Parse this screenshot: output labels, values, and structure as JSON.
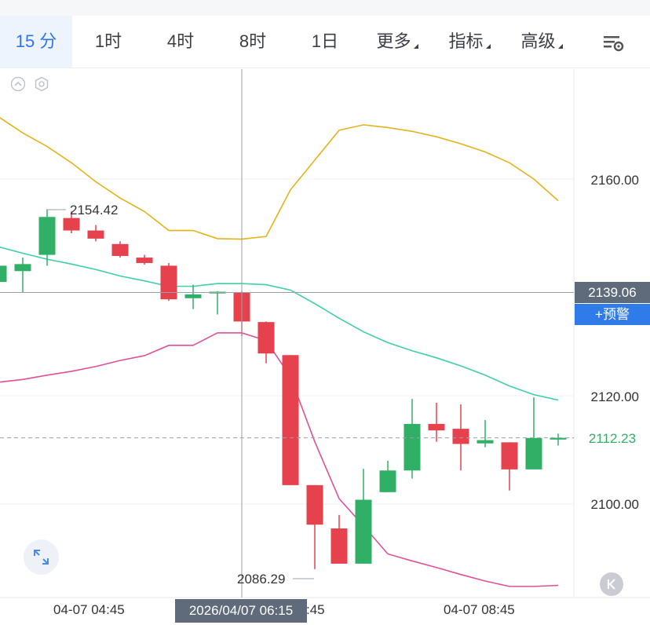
{
  "toolbar": {
    "tabs": [
      {
        "label": "15 分",
        "active": true
      },
      {
        "label": "1时"
      },
      {
        "label": "4时"
      },
      {
        "label": "8时"
      },
      {
        "label": "1日"
      },
      {
        "label": "更多",
        "dropdown": true
      },
      {
        "label": "指标",
        "dropdown": true
      },
      {
        "label": "高级",
        "dropdown": true
      }
    ],
    "settings_icon": "chart-settings-icon"
  },
  "controls": {
    "collapse_icon": "chevron-up-icon",
    "gear_icon": "gear-icon",
    "expand_icon": "expand-arrows-icon",
    "back_icon": "jump-to-latest-icon"
  },
  "price_axis": {
    "labels": [
      "2160.00",
      "2120.00",
      "2100.00"
    ],
    "cursor_price": "2139.06",
    "alert_label": "+预警",
    "last_price": "2112.23"
  },
  "time_axis": {
    "labels": [
      "04-07 04:45",
      ":45",
      "04-07 08:45"
    ],
    "cursor_time": "2026/04/07 06:15"
  },
  "annotations": {
    "high": "2154.42",
    "low": "2086.29"
  },
  "chart_data": {
    "type": "candlestick",
    "colors": {
      "up": "#2fb066",
      "down": "#e5424d",
      "upper_band": "#e6b21a",
      "middle_band": "#3fcfa8",
      "lower_band": "#e0509a"
    },
    "y_axis": {
      "ticks": [
        2160,
        2120,
        2100
      ],
      "range": [
        2083,
        2180
      ]
    },
    "x_axis": {
      "ticks": [
        "04-07 04:45",
        "04-07 06:45",
        "04-07 08:45"
      ]
    },
    "candles": [
      {
        "o": 2141.0,
        "h": 2143.5,
        "l": 2138.0,
        "c": 2144.0
      },
      {
        "o": 2143.0,
        "h": 2145.5,
        "l": 2139.0,
        "c": 2144.3
      },
      {
        "o": 2146.0,
        "h": 2154.42,
        "l": 2144.0,
        "c": 2153.0
      },
      {
        "o": 2152.8,
        "h": 2154.0,
        "l": 2150.0,
        "c": 2150.5
      },
      {
        "o": 2150.5,
        "h": 2151.5,
        "l": 2148.5,
        "c": 2149.0
      },
      {
        "o": 2148.0,
        "h": 2148.5,
        "l": 2145.5,
        "c": 2145.8
      },
      {
        "o": 2145.5,
        "h": 2146.0,
        "l": 2144.2,
        "c": 2144.5
      },
      {
        "o": 2144.0,
        "h": 2144.5,
        "l": 2137.5,
        "c": 2137.8
      },
      {
        "o": 2138.0,
        "h": 2140.5,
        "l": 2136.0,
        "c": 2138.7
      },
      {
        "o": 2138.9,
        "h": 2139.3,
        "l": 2135.0,
        "c": 2139.2
      },
      {
        "o": 2139.1,
        "h": 2139.3,
        "l": 2131.0,
        "c": 2133.7
      },
      {
        "o": 2133.6,
        "h": 2133.7,
        "l": 2126.0,
        "c": 2127.8
      },
      {
        "o": 2127.5,
        "h": 2127.5,
        "l": 2103.5,
        "c": 2103.5
      },
      {
        "o": 2103.5,
        "h": 2103.5,
        "l": 2088.0,
        "c": 2096.2
      },
      {
        "o": 2095.5,
        "h": 2098.0,
        "l": 2089.0,
        "c": 2089.0
      },
      {
        "o": 2089.0,
        "h": 2106.5,
        "l": 2089.0,
        "c": 2100.8
      },
      {
        "o": 2102.2,
        "h": 2108.0,
        "l": 2102.2,
        "c": 2106.2
      },
      {
        "o": 2106.2,
        "h": 2119.4,
        "l": 2104.7,
        "c": 2114.8
      },
      {
        "o": 2114.8,
        "h": 2118.7,
        "l": 2111.5,
        "c": 2113.6
      },
      {
        "o": 2113.9,
        "h": 2118.4,
        "l": 2106.2,
        "c": 2111.1
      },
      {
        "o": 2111.2,
        "h": 2115.5,
        "l": 2110.5,
        "c": 2111.8
      },
      {
        "o": 2111.4,
        "h": 2111.4,
        "l": 2102.5,
        "c": 2106.4
      },
      {
        "o": 2106.4,
        "h": 2119.7,
        "l": 2106.4,
        "c": 2112.2
      },
      {
        "o": 2112.2,
        "h": 2113.0,
        "l": 2110.8,
        "c": 2112.23
      }
    ],
    "bands": {
      "upper": [
        2171.5,
        2168.5,
        2166.0,
        2163.0,
        2159.5,
        2156.5,
        2154.0,
        2150.5,
        2150.5,
        2149.0,
        2148.9,
        2149.4,
        2158.0,
        2163.5,
        2169.0,
        2170.0,
        2169.5,
        2168.8,
        2167.8,
        2166.5,
        2165.0,
        2163.0,
        2160.0,
        2156.0
      ],
      "middle": [
        2147.5,
        2146.3,
        2145.2,
        2144.3,
        2143.3,
        2142.1,
        2141.2,
        2140.2,
        2140.2,
        2140.7,
        2140.7,
        2140.5,
        2139.5,
        2137.0,
        2134.3,
        2131.8,
        2129.8,
        2128.3,
        2127.0,
        2125.5,
        2123.8,
        2121.8,
        2120.2,
        2119.2
      ],
      "lower": [
        2122.5,
        2123.0,
        2123.8,
        2124.5,
        2125.4,
        2126.5,
        2127.4,
        2129.3,
        2129.3,
        2131.6,
        2131.6,
        2130.2,
        2123.5,
        2111.5,
        2101.0,
        2096.0,
        2090.8,
        2089.5,
        2088.3,
        2087.0,
        2085.8,
        2084.8,
        2084.8,
        2085.0
      ]
    }
  }
}
